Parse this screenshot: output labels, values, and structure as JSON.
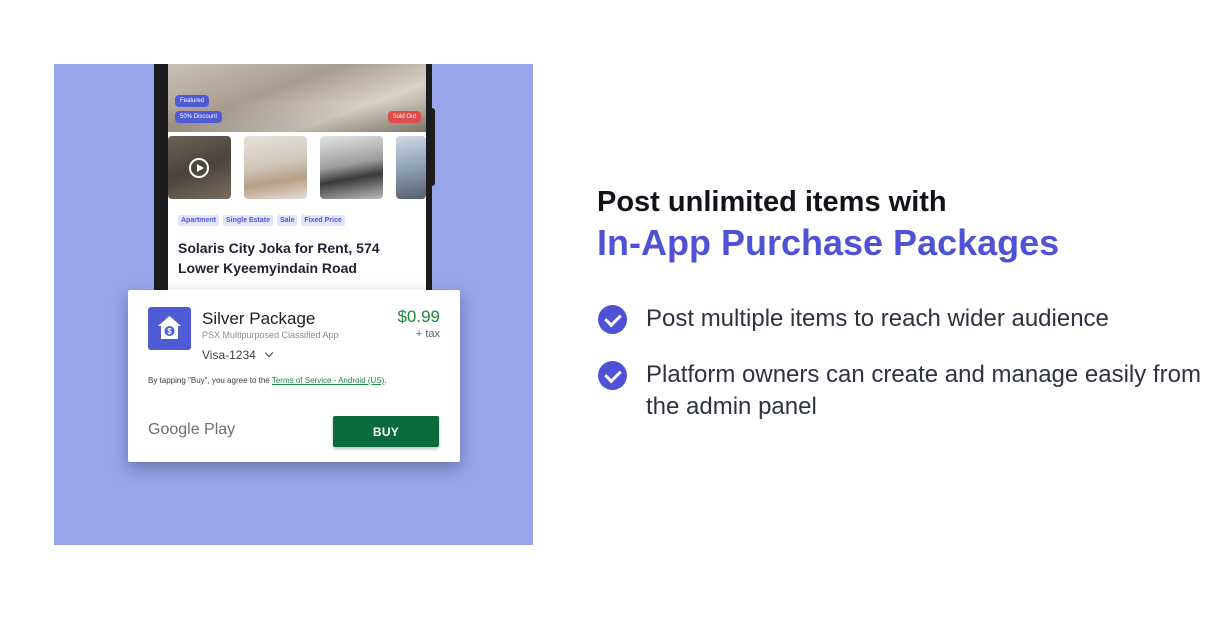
{
  "phone": {
    "badges": {
      "featured": "Featured",
      "discount": "50% Discount",
      "sold_out": "Sold Out"
    },
    "tags": [
      "Apartment",
      "Single Estate",
      "Sale",
      "Fixed Price"
    ],
    "listing_title": "Solaris City Joka for Rent, 574 Lower Kyeemyindain Road"
  },
  "purchase_dialog": {
    "package_name": "Silver Package",
    "app_name": "PSX Multipurposed Classified App",
    "price": "$0.99",
    "tax": "+ tax",
    "payment_method": "Visa-1234",
    "terms_prefix": "By tapping \"Buy\", you agree to the ",
    "terms_link": "Terms of Service - Android (US)",
    "terms_suffix": ".",
    "store_logo": "Google Play",
    "buy_label": "BUY"
  },
  "headline": {
    "line1": "Post unlimited items with",
    "line2": "In-App Purchase Packages"
  },
  "features": [
    {
      "text": "Post multiple items to reach wider audience",
      "icon": "check-circle-icon"
    },
    {
      "text": "Platform owners can create and manage easily from the admin panel",
      "icon": "check-circle-icon"
    }
  ],
  "colors": {
    "accent": "#4f52d6",
    "panel_background": "#98a5ea",
    "price_green": "#1a8a3e",
    "buy_button": "#0b6b3a"
  }
}
